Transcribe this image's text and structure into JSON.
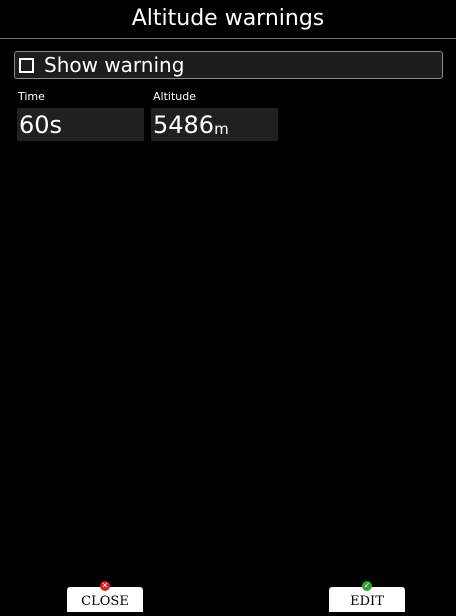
{
  "header": {
    "title": "Altitude warnings"
  },
  "show_warning": {
    "label": "Show warning",
    "checked": false
  },
  "time_field": {
    "label": "Time",
    "value": "60s"
  },
  "altitude_field": {
    "label": "Altitude",
    "value": "5486",
    "unit": "m"
  },
  "footer": {
    "close_label": "CLOSE",
    "edit_label": "EDIT",
    "close_icon": "red-x-icon",
    "edit_icon": "green-check-icon"
  },
  "colors": {
    "background": "#000000",
    "field_background": "#202020",
    "close_icon": "#d81f1f",
    "edit_icon": "#2fa32f"
  }
}
